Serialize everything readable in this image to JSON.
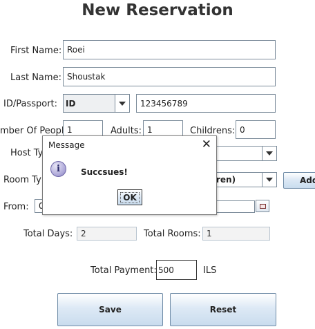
{
  "page_title": "New Reservation",
  "form": {
    "first_name_label": "First Name:",
    "first_name_value": "Roei",
    "last_name_label": "Last Name:",
    "last_name_value": "Shoustak",
    "id_passport_label": "ID/Passport:",
    "id_type_value": "ID",
    "id_number_value": "123456789",
    "number_of_people_label": "mber Of People:",
    "number_of_people_value": "1",
    "adults_label": "Adults:",
    "adults_value": "1",
    "childrens_label": "Childrens:",
    "childrens_value": "0",
    "host_type_label": "Host Ty",
    "room_type_label": "Room Ty",
    "room_type_value": "ren)",
    "add_button_label": "Add",
    "from_label": "From:",
    "from_value": "0",
    "total_days_label": "Total Days:",
    "total_days_value": "2",
    "total_rooms_label": "Total Rooms:",
    "total_rooms_value": "1",
    "total_payment_label": "Total Payment:",
    "total_payment_value": "500",
    "currency_label": "ILS",
    "save_label": "Save",
    "reset_label": "Reset"
  },
  "dialog": {
    "title": "Message",
    "close_glyph": "✕",
    "icon_glyph": "i",
    "message": "Succsues!",
    "ok_label": "OK"
  },
  "icons": {
    "dropdown": "chevron-down-icon",
    "calendar": "calendar-icon",
    "info": "info-icon",
    "close": "close-icon"
  }
}
